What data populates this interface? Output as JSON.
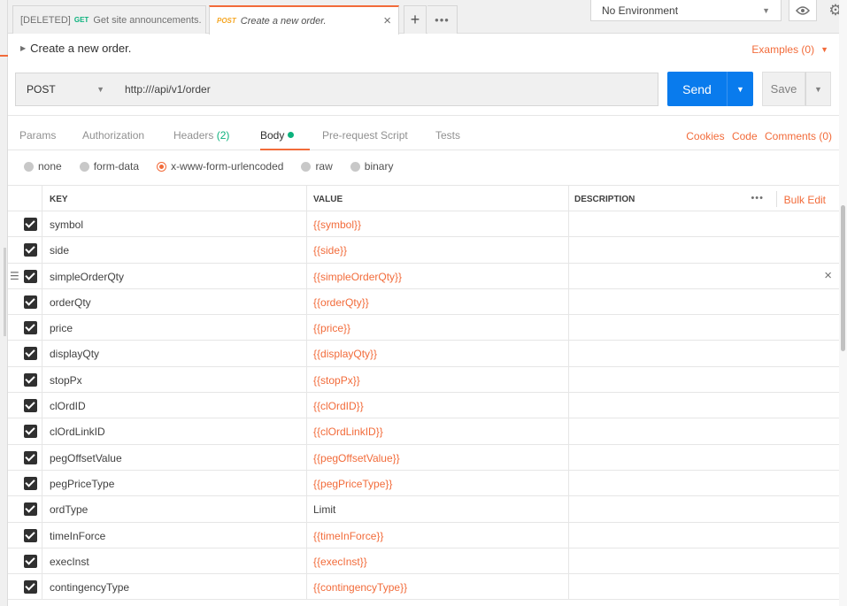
{
  "tabs": [
    {
      "prefix": "[DELETED]",
      "method": "GET",
      "title": "Get site announcements."
    },
    {
      "method": "POST",
      "title": "Create a new order.",
      "close": "×"
    }
  ],
  "tabbar": {
    "new_tab": "+",
    "more": "•••"
  },
  "environment": {
    "selected": "No Environment"
  },
  "request": {
    "name": "Create a new order.",
    "examples_label": "Examples (0)",
    "method": "POST",
    "url": "http:///api/v1/order",
    "send_label": "Send",
    "save_label": "Save"
  },
  "subtabs": {
    "params": "Params",
    "authorization": "Authorization",
    "headers": "Headers",
    "headers_count": "(2)",
    "body": "Body",
    "pre_request": "Pre-request Script",
    "tests": "Tests",
    "cookies": "Cookies",
    "code": "Code",
    "comments": "Comments (0)"
  },
  "body_modes": [
    "none",
    "form-data",
    "x-www-form-urlencoded",
    "raw",
    "binary"
  ],
  "body_mode_selected": "x-www-form-urlencoded",
  "table": {
    "headers": {
      "key": "KEY",
      "value": "VALUE",
      "description": "DESCRIPTION"
    },
    "more": "•••",
    "bulk_edit": "Bulk Edit",
    "rows": [
      {
        "key": "symbol",
        "value": "{{symbol}}"
      },
      {
        "key": "side",
        "value": "{{side}}"
      },
      {
        "key": "simpleOrderQty",
        "value": "{{simpleOrderQty}}"
      },
      {
        "key": "orderQty",
        "value": "{{orderQty}}"
      },
      {
        "key": "price",
        "value": "{{price}}"
      },
      {
        "key": "displayQty",
        "value": "{{displayQty}}"
      },
      {
        "key": "stopPx",
        "value": "{{stopPx}}"
      },
      {
        "key": "clOrdID",
        "value": "{{clOrdID}}"
      },
      {
        "key": "clOrdLinkID",
        "value": "{{clOrdLinkID}}"
      },
      {
        "key": "pegOffsetValue",
        "value": "{{pegOffsetValue}}"
      },
      {
        "key": "pegPriceType",
        "value": "{{pegPriceType}}"
      },
      {
        "key": "ordType",
        "value": "Limit"
      },
      {
        "key": "timeInForce",
        "value": "{{timeInForce}}"
      },
      {
        "key": "execInst",
        "value": "{{execInst}}"
      },
      {
        "key": "contingencyType",
        "value": "{{contingencyType}}"
      }
    ]
  },
  "colors": {
    "accent": "#f26b3a",
    "primary": "#097bed",
    "success": "#0cb27d"
  }
}
